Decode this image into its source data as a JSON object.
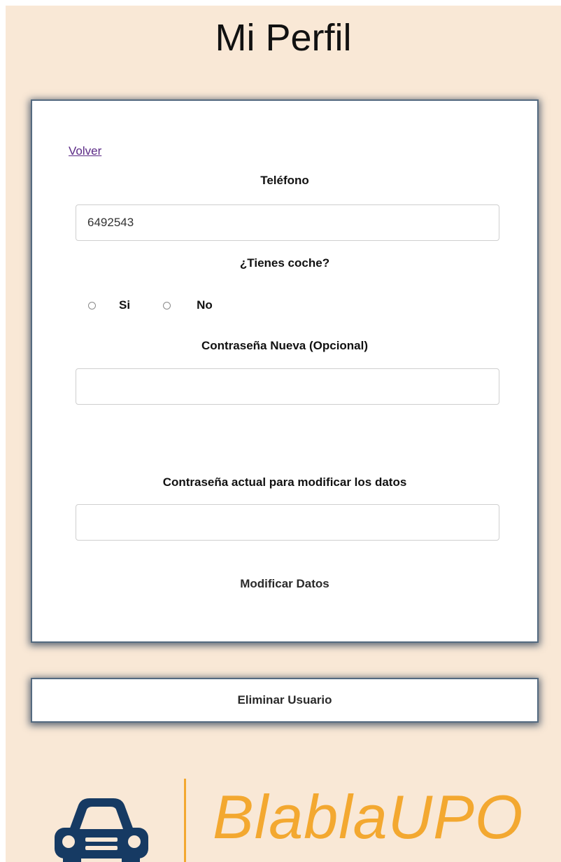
{
  "page": {
    "title": "Mi Perfil"
  },
  "form": {
    "back_link": "Volver",
    "phone": {
      "label": "Teléfono",
      "value": "6492543"
    },
    "car": {
      "label": "¿Tienes coche?",
      "options": [
        "Si",
        "No"
      ]
    },
    "new_password": {
      "label": "Contraseña Nueva (Opcional)",
      "value": ""
    },
    "current_password": {
      "label": "Contraseña actual para modificar los datos",
      "value": ""
    },
    "submit_label": "Modificar Datos"
  },
  "delete_user_label": "Eliminar Usuario",
  "logo": {
    "text": "BlablaUPO",
    "icon": "car-icon",
    "accent_color": "#f3a830",
    "icon_color": "#163a63"
  },
  "colors": {
    "background": "#f9e8d6",
    "card_border": "#546a80"
  }
}
